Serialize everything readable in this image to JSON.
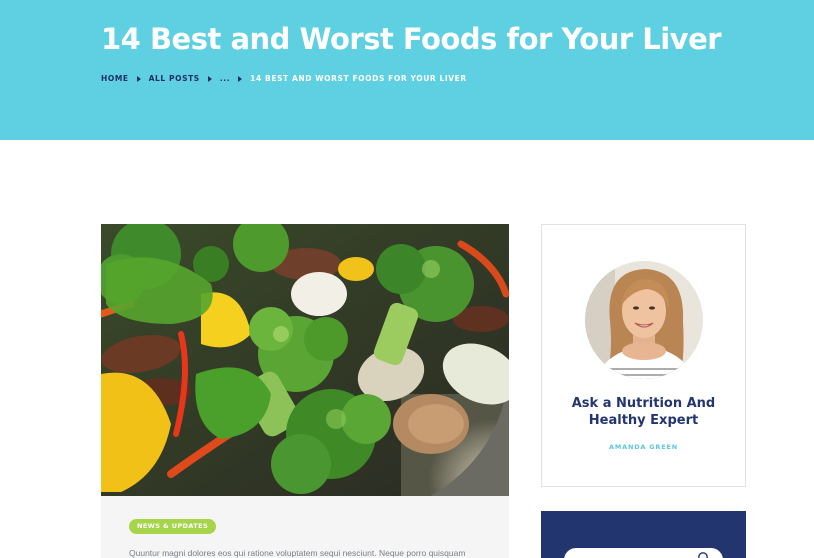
{
  "header": {
    "title": "14 Best and Worst Foods for Your Liver",
    "breadcrumb": {
      "home": "HOME",
      "all_posts": "ALL POSTS",
      "ellipsis": "...",
      "current": "14 BEST AND WORST FOODS FOR YOUR LIVER"
    }
  },
  "post": {
    "category": "NEWS & UPDATES",
    "excerpt": "Quuntur magni dolores eos qui ratione voluptatem sequi nesciunt. Neque porro quisquam"
  },
  "sidebar": {
    "author_card": {
      "title": "Ask a Nutrition And Healthy Expert",
      "name": "AMANDA GREEN"
    },
    "search": {
      "placeholder": "",
      "icon": "search-icon"
    }
  },
  "colors": {
    "hero_bg": "#5ed0e2",
    "navy": "#22356f",
    "badge_green": "#a6d44a",
    "accent_cyan": "#5ec6dc"
  }
}
